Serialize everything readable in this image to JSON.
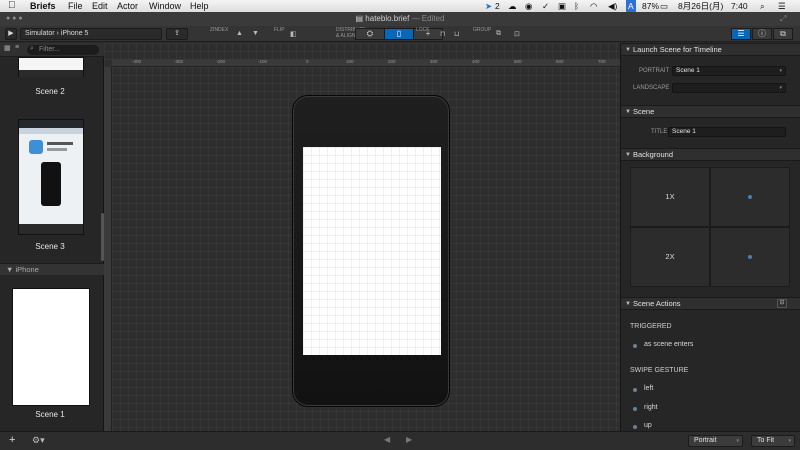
{
  "menubar": {
    "apple": "",
    "app_name": "Briefs",
    "menus": [
      "File",
      "Edit",
      "Actor",
      "Window",
      "Help"
    ],
    "status_badge": "2",
    "battery": "87%",
    "ime": "A",
    "date": "8月26日(月)",
    "time": "7:40"
  },
  "window": {
    "filename": "hateblo.brief",
    "edited": "— Edited"
  },
  "toolbar": {
    "device_path": "Simulator  ›  iPhone 5",
    "labels": {
      "zindex": "ZINDEX",
      "flip": "FLIP",
      "distribute": "DISTRIBUTE & ALIGN",
      "lock": "LOCK",
      "group": "GROUP"
    }
  },
  "left_panel": {
    "filter_placeholder": "Filter...",
    "scenes_top": [
      {
        "label": "Scene 2"
      },
      {
        "label": "Scene 3"
      }
    ],
    "group_name": "iPhone",
    "scenes_group": [
      {
        "label": "Scene 1"
      }
    ]
  },
  "canvas": {
    "ruler_ticks": [
      "-400",
      "-300",
      "-200",
      "-100",
      "0",
      "100",
      "200",
      "300",
      "400",
      "500",
      "600",
      "700"
    ]
  },
  "right_panel": {
    "launch": {
      "title": "Launch Scene for Timeline",
      "portrait_label": "PORTRAIT",
      "portrait_value": "Scene 1",
      "landscape_label": "LANDSCAPE",
      "landscape_value": ""
    },
    "scene": {
      "title": "Scene",
      "title_label": "TITLE",
      "title_value": "Scene 1"
    },
    "background": {
      "title": "Background",
      "row1": "1X",
      "row2": "2X"
    },
    "actions": {
      "title": "Scene Actions",
      "triggered": "TRIGGERED",
      "as_scene_enters": "as scene enters",
      "swipe_gesture": "SWIPE GESTURE",
      "swipes": [
        "left",
        "right",
        "up"
      ]
    }
  },
  "bottombar": {
    "orientation": "Portrait",
    "zoom": "To Fit"
  },
  "colors": {
    "accent": "#0a66b7",
    "panel": "#262626",
    "canvas": "#2e2e2e"
  }
}
